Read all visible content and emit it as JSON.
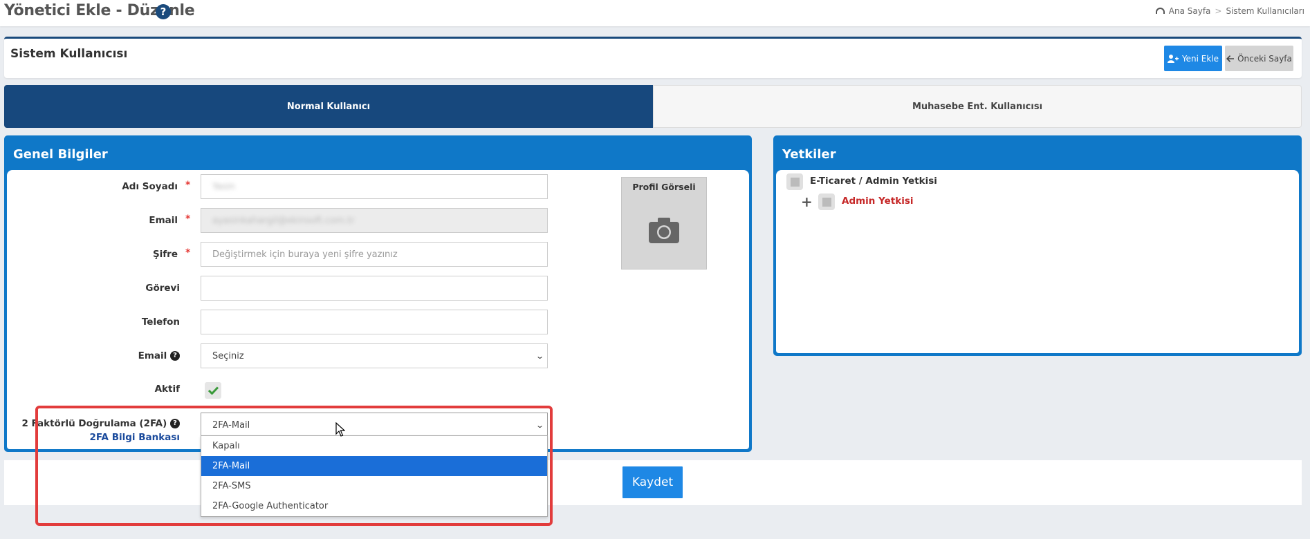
{
  "header": {
    "title": "Yönetici Ekle - Düzenle",
    "help_icon": "?",
    "breadcrumb": {
      "home": "Ana Sayfa",
      "separator": ">",
      "current": "Sistem Kullanıcıları"
    }
  },
  "panel": {
    "title": "Sistem Kullanıcısı",
    "new_button": "Yeni Ekle",
    "back_button": "Önceki Sayfa"
  },
  "tabs": [
    {
      "label": "Normal Kullanıcı",
      "active": true
    },
    {
      "label": "Muhasebe Ent. Kullanıcısı",
      "active": false
    }
  ],
  "genel": {
    "title": "Genel Bilgiler",
    "required_mark": "*",
    "fields": {
      "name": {
        "label": "Adı Soyadı",
        "value": "Yasin"
      },
      "email": {
        "label": "Email",
        "value": "ayasinkahargil@ekinsoft.com.tr"
      },
      "password": {
        "label": "Şifre",
        "placeholder": "Değiştirmek için buraya yeni şifre yazınız"
      },
      "role": {
        "label": "Görevi",
        "value": ""
      },
      "phone": {
        "label": "Telefon",
        "value": ""
      },
      "email_select": {
        "label": "Email",
        "value": "Seçiniz"
      },
      "active": {
        "label": "Aktif",
        "checked": true
      },
      "twofa": {
        "label": "2 Faktörlü Doğrulama (2FA)",
        "link": "2FA Bilgi Bankası",
        "value": "2FA-Mail",
        "options": [
          "Kapalı",
          "2FA-Mail",
          "2FA-SMS",
          "2FA-Google Authenticator"
        ],
        "selected_index": 1
      }
    },
    "profile": {
      "label": "Profil Görseli",
      "icon": "camera-icon"
    }
  },
  "save": {
    "label": "Kaydet"
  },
  "yetkiler": {
    "title": "Yetkiler",
    "root": "E-Ticaret / Admin Yetkisi",
    "child": "Admin Yetkisi",
    "expand_symbol": "+"
  },
  "colors": {
    "primary": "#1e88e5",
    "navy": "#17487d",
    "panel_blue": "#0f78c8",
    "highlight": "#e23c3c",
    "child_red": "#c62828"
  }
}
